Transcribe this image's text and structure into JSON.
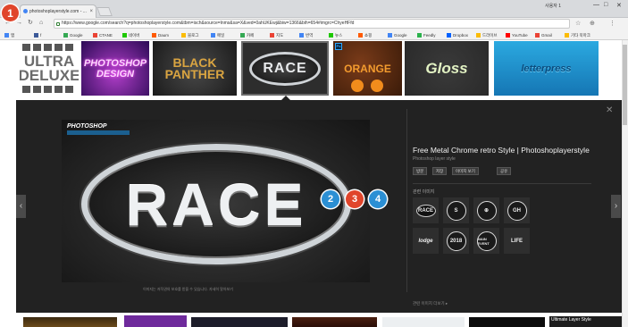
{
  "browser": {
    "tab_title": "photoshoplayerstyle.com - ...",
    "tab_close": "×",
    "window_user": "사용자 1",
    "window_controls": [
      "—",
      "□",
      "✕"
    ],
    "nav": {
      "back": "←",
      "forward": "→",
      "reload": "↻",
      "home": "⌂"
    },
    "url": "https://www.google.com/search?q=photoshoplayerstyle.com&tbm=isch&source=lnms&sa=X&ved=0ahUKEwj&biw=1366&bih=654#imgrc=ChyeHFfd",
    "toolbar_icons": [
      "☆",
      "⊕",
      "⋮"
    ],
    "bookmarks": [
      {
        "label": "앱",
        "color": "#4285f4"
      },
      {
        "label": "f",
        "color": "#3b5998"
      },
      {
        "label": "Google",
        "color": "#34a853"
      },
      {
        "label": "CTANE",
        "color": "#ea4335"
      },
      {
        "label": "네이버",
        "color": "#1ec800"
      },
      {
        "label": "Daum",
        "color": "#ff5a00"
      },
      {
        "label": "블로그",
        "color": "#fbbc05"
      },
      {
        "label": "메일",
        "color": "#4285f4"
      },
      {
        "label": "카페",
        "color": "#34a853"
      },
      {
        "label": "지도",
        "color": "#ea4335"
      },
      {
        "label": "번역",
        "color": "#4285f4"
      },
      {
        "label": "뉴스",
        "color": "#1ec800"
      },
      {
        "label": "쇼핑",
        "color": "#ff5a00"
      },
      {
        "label": "Google",
        "color": "#4285f4"
      },
      {
        "label": "Feedly",
        "color": "#2bb24c"
      },
      {
        "label": "Dropbox",
        "color": "#0061ff"
      },
      {
        "label": "드라이브",
        "color": "#fbbc05"
      },
      {
        "label": "YouTube",
        "color": "#ff0000"
      },
      {
        "label": "Gmail",
        "color": "#ea4335"
      },
      {
        "label": "기타 북마크",
        "color": "#fbbc05"
      }
    ]
  },
  "strip": {
    "thumbs": [
      {
        "label": "ULTRA DELUXE"
      },
      {
        "label": "PHOTOSHOP DESIGN"
      },
      {
        "label": "BLACK PANTHER"
      },
      {
        "label": "RACE"
      },
      {
        "label": "ORANGE"
      },
      {
        "label": "Gloss"
      },
      {
        "label": "letterpress"
      }
    ]
  },
  "panel": {
    "close": "✕",
    "prev": "‹",
    "next": "›",
    "image": {
      "brand": "PHOTOSHOP",
      "word": "RACE"
    },
    "caption": "이미지는 저작권의 보호를 받을 수 있습니다. 자세히 알아보기",
    "title": "Free Metal Chrome retro Style | Photoshoplayerstyle",
    "source": "Photoshop layer style",
    "buttons": [
      "방문",
      "저장",
      "이미지 보기",
      "공유"
    ],
    "related_label": "관련 이미지",
    "related": [
      "RACE",
      "S",
      "⊕",
      "GH",
      "lodge",
      "2018",
      "MAIN EVENT",
      "LIFE"
    ],
    "more": "관련 이미지 더보기 ▸"
  },
  "bottom": {
    "last_caption": "Ultimate Layer Style"
  },
  "markers": [
    "1",
    "2",
    "3",
    "4"
  ]
}
